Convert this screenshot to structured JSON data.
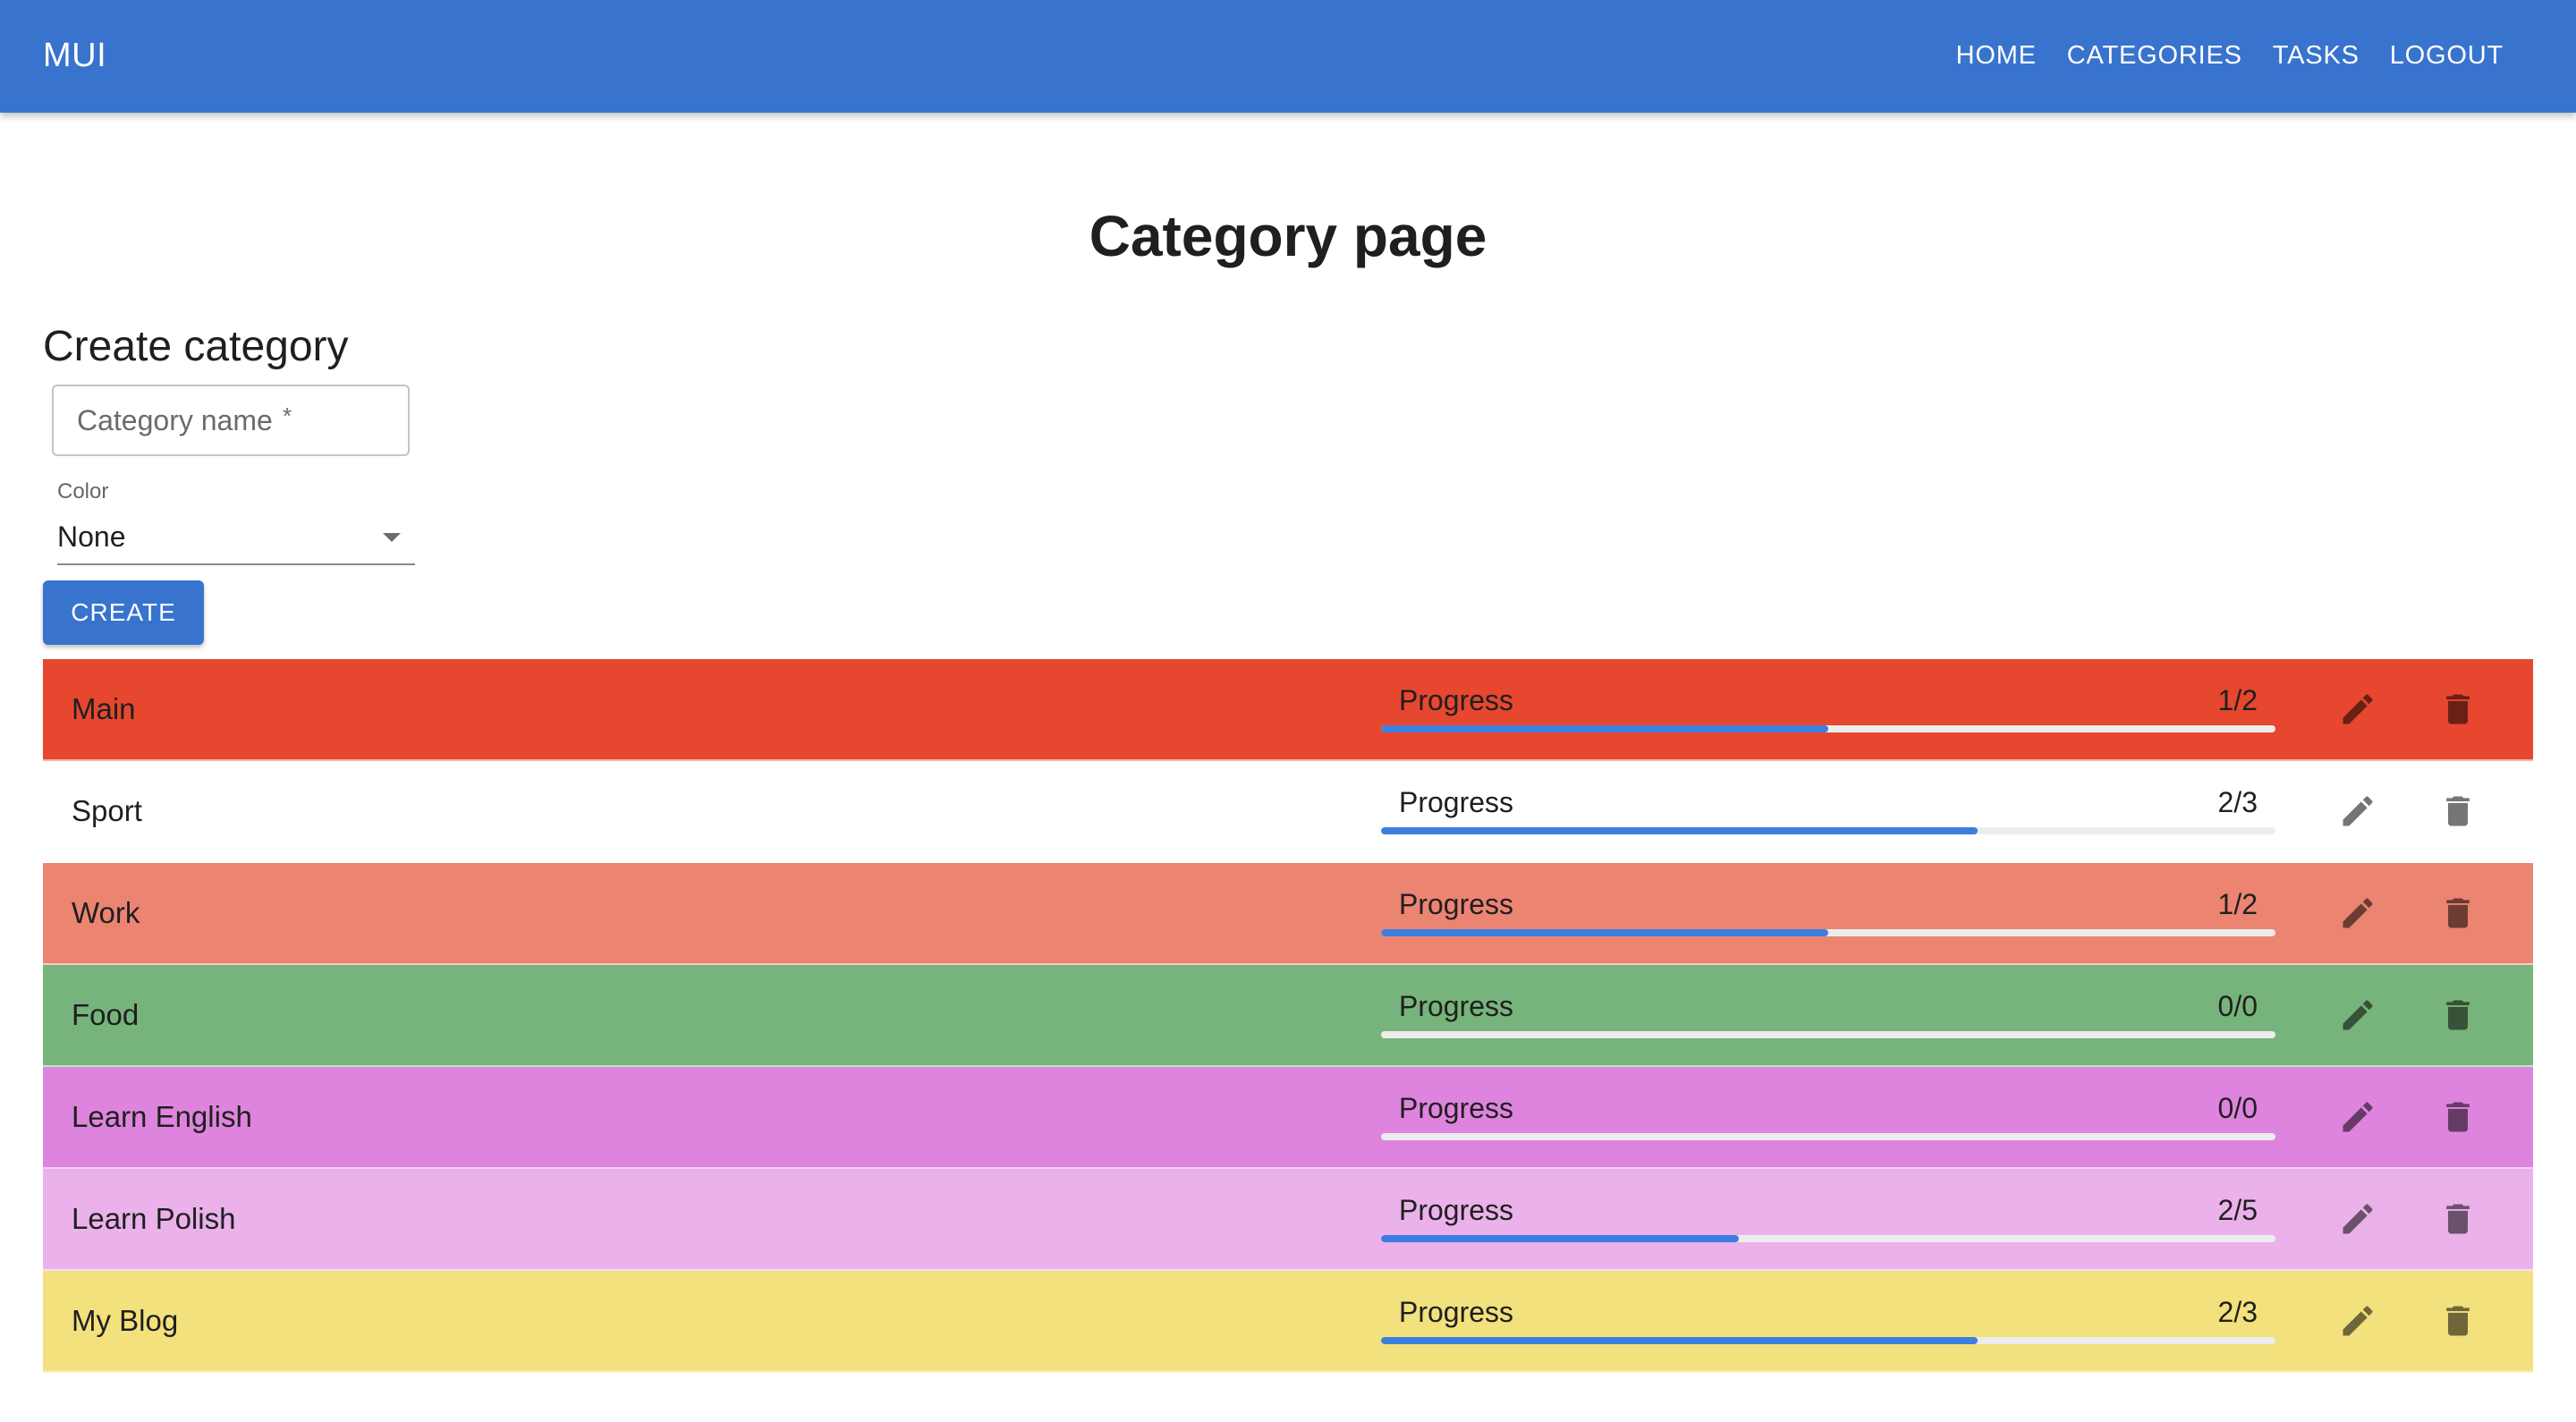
{
  "app": {
    "brand": "MUI",
    "nav": [
      "HOME",
      "CATEGORIES",
      "TASKS",
      "LOGOUT"
    ],
    "accent_color": "#3873cd"
  },
  "page": {
    "title": "Category page"
  },
  "create_form": {
    "heading": "Create category",
    "name_placeholder": "Category name",
    "name_required_mark": "*",
    "name_value": "",
    "color_label": "Color",
    "color_value": "None",
    "create_label": "CREATE"
  },
  "categories": [
    {
      "name": "Main",
      "progress_label": "Progress",
      "progress_text": "1/2",
      "progress_fraction": 0.5,
      "bg": "#e6472e"
    },
    {
      "name": "Sport",
      "progress_label": "Progress",
      "progress_text": "2/3",
      "progress_fraction": 0.667,
      "bg": "#ffffff"
    },
    {
      "name": "Work",
      "progress_label": "Progress",
      "progress_text": "1/2",
      "progress_fraction": 0.5,
      "bg": "#ec8472"
    },
    {
      "name": "Food",
      "progress_label": "Progress",
      "progress_text": "0/0",
      "progress_fraction": 0,
      "bg": "#76b47b"
    },
    {
      "name": "Learn English",
      "progress_label": "Progress",
      "progress_text": "0/0",
      "progress_fraction": 0,
      "bg": "#de84de"
    },
    {
      "name": "Learn Polish",
      "progress_label": "Progress",
      "progress_text": "2/5",
      "progress_fraction": 0.4,
      "bg": "#ebb1ea"
    },
    {
      "name": "My Blog",
      "progress_label": "Progress",
      "progress_text": "2/3",
      "progress_fraction": 0.667,
      "bg": "#f2e17c"
    }
  ],
  "icons": {
    "edit": "edit-pencil-icon",
    "delete": "delete-trash-icon"
  }
}
